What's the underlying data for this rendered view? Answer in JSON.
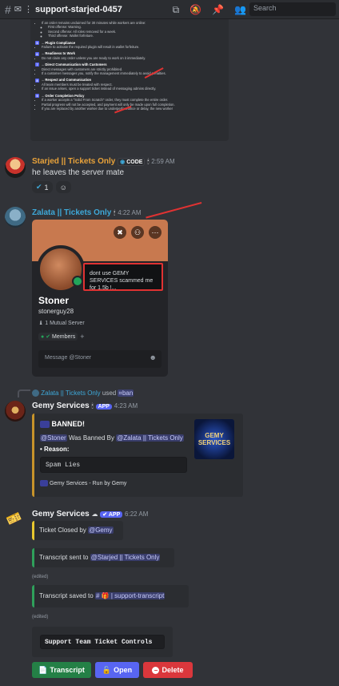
{
  "header": {
    "channel": "support-starjed-0457",
    "search_placeholder": "Search"
  },
  "rules_image": {
    "intro_bullets": [
      "If an order remains unclaimed for 30 minutes while workers are online:"
    ],
    "penalties": [
      "First offense: Warning.",
      "Second offense: All roles removed for a week.",
      "Third offense: Wallet forfeiture."
    ],
    "sections": [
      {
        "num": "5",
        "title": "→ Plugin Compliance",
        "items": [
          "Failure to activate the required plugin will result in wallet forfeiture."
        ]
      },
      {
        "num": "6",
        "title": "→ Readiness to Work",
        "items": [
          "Do not claim any order unless you are ready to work on it immediately."
        ]
      },
      {
        "num": "7",
        "title": "→ Direct Communication with Customers",
        "items": [
          "Direct messages with customers are strictly prohibited.",
          "If a customer messages you, notify the management immediately to avoid penalties."
        ]
      },
      {
        "num": "8",
        "title": "→ Respect and Communication",
        "items": [
          "All team members must be treated with respect.",
          "If an issue arises, open a support ticket instead of messaging admins directly."
        ]
      },
      {
        "num": "9",
        "title": "→ Order Completion Policy",
        "items": [
          "If a worker accepts a \"Solid From Scratch\" order, they must complete the entire order.",
          "Partial progress will not be accepted, and payment will only be made upon full completion.",
          "If you are replaced by another worker due to underperformance or delay, the new worker"
        ]
      }
    ]
  },
  "msg1": {
    "username": "Starjed || Tickets Only",
    "tag": "CODE",
    "timestamp": "2:59 AM",
    "text": "he leaves the server mate",
    "reaction_count": "1"
  },
  "msg2": {
    "username": "Zalata || Tickets Only",
    "timestamp": "4:22 AM"
  },
  "profile": {
    "bubble": "dont use GEMY SERVICES scammed me for 1.5b !...",
    "display_name": "Stoner",
    "username": "stonerguy28",
    "mutual": "1 Mutual Server",
    "role": "Members",
    "message_placeholder": "Message @Stoner"
  },
  "msg3": {
    "reply_user": "Zalata || Tickets Only",
    "reply_used": "used",
    "reply_cmd": "ban",
    "username": "Gemy Services",
    "app": "APP",
    "timestamp": "4:23 AM",
    "embed_title": "BANNED!",
    "target": "@Stoner",
    "was_banned_by": "Was Banned By",
    "banner": "@Zalata || Tickets Only",
    "reason_label": "Reason:",
    "reason": "Spam Lies",
    "footer": "Gemy Services - Run by Gemy",
    "thumb_line1": "GEMY",
    "thumb_line2": "SERVICES"
  },
  "msg4": {
    "username": "Gemy Services",
    "app": "APP",
    "timestamp": "6:22 AM",
    "closed_text": "Ticket Closed by",
    "closed_by": "@Gemy",
    "transcript_sent": "Transcript sent to",
    "sent_to": "@Starjed || Tickets Only",
    "edited": "(edited)",
    "transcript_saved": "Transcript saved to",
    "saved_channel": "support-transcript",
    "controls_title": "Support Team Ticket Controls",
    "buttons": {
      "transcript": "Transcript",
      "open": "Open",
      "delete": "Delete"
    }
  },
  "colors": {
    "starjed": "#e8a23a",
    "zalata": "#3ea8d8",
    "blurple": "#5865f2",
    "green": "#248046",
    "red": "#da373c",
    "arrow": "#e03232"
  }
}
